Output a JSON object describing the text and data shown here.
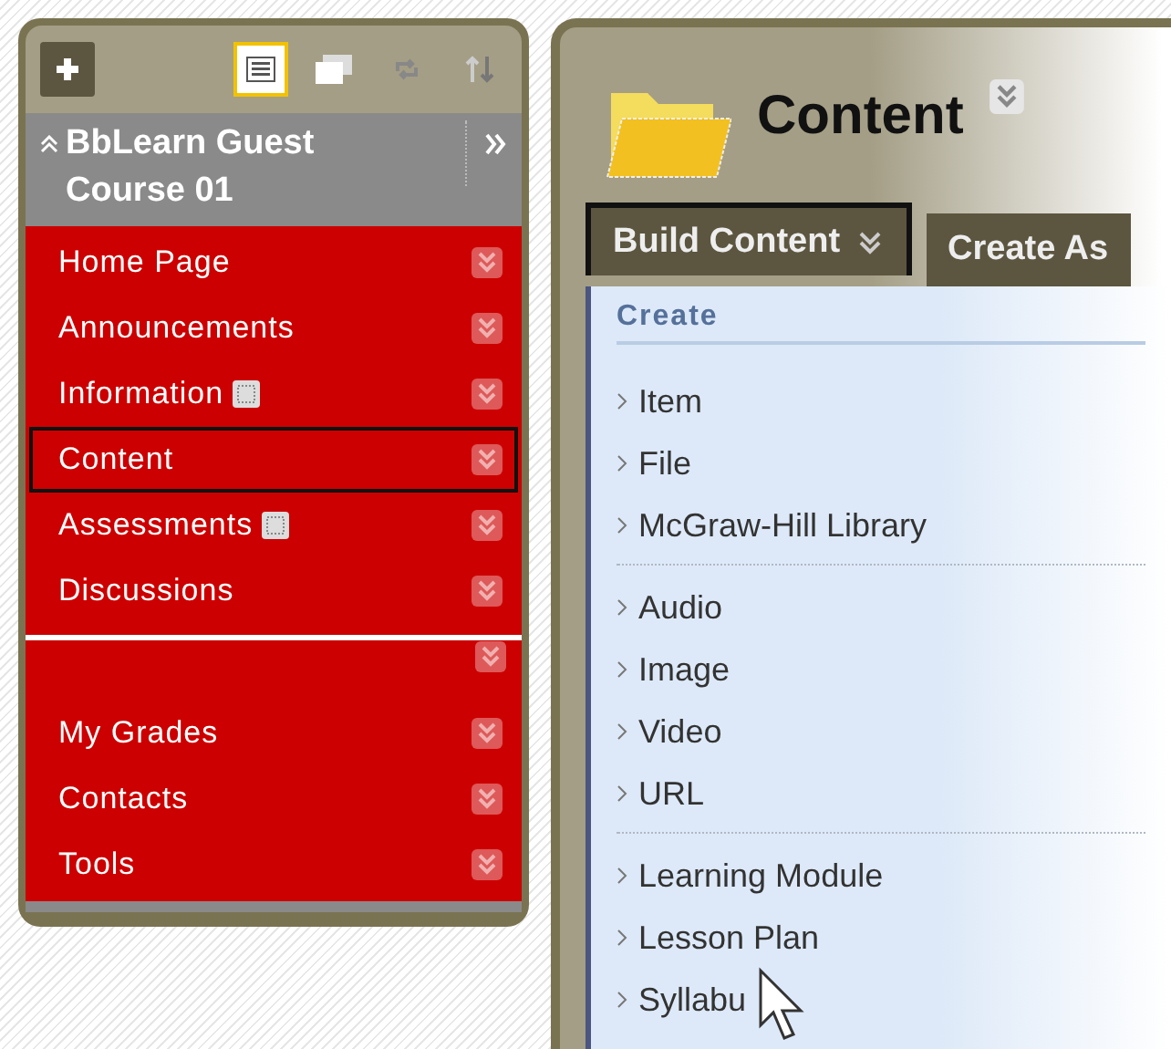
{
  "toolbar": {
    "views": [
      {
        "kind": "list",
        "selected": true
      },
      {
        "kind": "folder",
        "selected": false
      },
      {
        "kind": "refresh",
        "selected": false
      },
      {
        "kind": "sort",
        "selected": false
      }
    ]
  },
  "course": {
    "title": "BbLearn Guest Course 01"
  },
  "menu_items": [
    {
      "kind": "link",
      "label": "Home Page",
      "badge": false,
      "selected": false
    },
    {
      "kind": "link",
      "label": "Announcements",
      "badge": false,
      "selected": false
    },
    {
      "kind": "link",
      "label": "Information",
      "badge": true,
      "selected": false
    },
    {
      "kind": "link",
      "label": "Content",
      "badge": false,
      "selected": true
    },
    {
      "kind": "link",
      "label": "Assessments",
      "badge": true,
      "selected": false
    },
    {
      "kind": "link",
      "label": "Discussions",
      "badge": false,
      "selected": false
    },
    {
      "kind": "divider"
    },
    {
      "kind": "link",
      "label": "My Grades",
      "badge": false,
      "selected": false
    },
    {
      "kind": "link",
      "label": "Contacts",
      "badge": false,
      "selected": false
    },
    {
      "kind": "link",
      "label": "Tools",
      "badge": false,
      "selected": false
    }
  ],
  "page": {
    "title": "Content"
  },
  "action_tabs": [
    {
      "label": "Build Content",
      "selected": true
    },
    {
      "label": "Create As",
      "selected": false
    }
  ],
  "dropdown": {
    "heading": "Create",
    "groups": [
      [
        "Item",
        "File",
        "McGraw-Hill Library"
      ],
      [
        "Audio",
        "Image",
        "Video",
        "URL"
      ],
      [
        "Learning Module",
        "Lesson Plan",
        "Syllabu"
      ]
    ]
  }
}
